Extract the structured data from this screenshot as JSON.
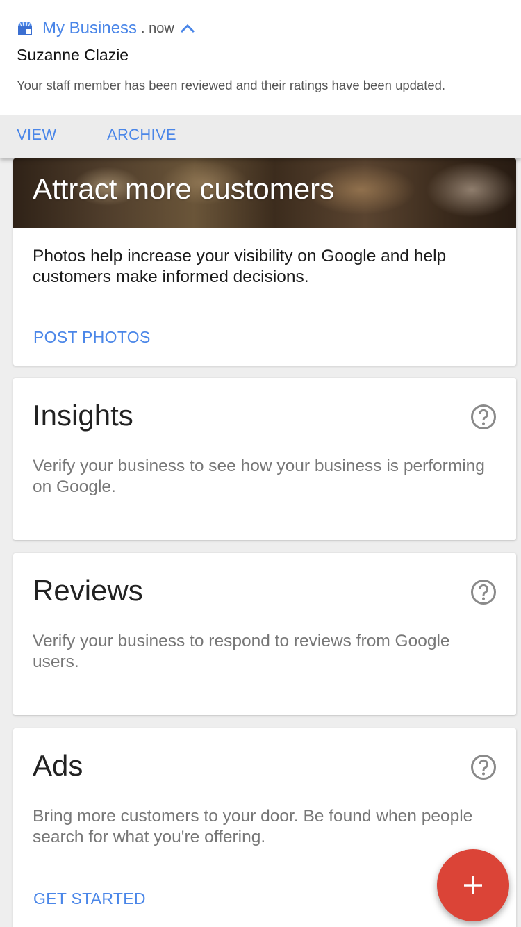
{
  "notification": {
    "app_name": "My Business",
    "time": ". now",
    "title": "Suzanne Clazie",
    "text": "Your staff member has been reviewed and their ratings have been updated.",
    "actions": {
      "view": "VIEW",
      "archive": "ARCHIVE"
    }
  },
  "cards": {
    "photos": {
      "hero_title": "Attract more customers",
      "body": "Photos help increase your visibility on Google and help customers make informed decisions.",
      "action": "POST PHOTOS"
    },
    "insights": {
      "title": "Insights",
      "description": "Verify your business to see how your business is performing on Google."
    },
    "reviews": {
      "title": "Reviews",
      "description": "Verify your business to respond to reviews from Google users."
    },
    "ads": {
      "title": "Ads",
      "description": "Bring more customers to your door. Be found when people search for what you're offering.",
      "action": "GET STARTED"
    }
  },
  "fab": {
    "icon": "plus-icon"
  },
  "icons": {
    "app": "my-business-icon",
    "collapse": "chevron-up-icon",
    "help": "help-circle-icon"
  },
  "colors": {
    "accent": "#4a86e8",
    "fab": "#db4437",
    "background": "#eeeeee"
  }
}
